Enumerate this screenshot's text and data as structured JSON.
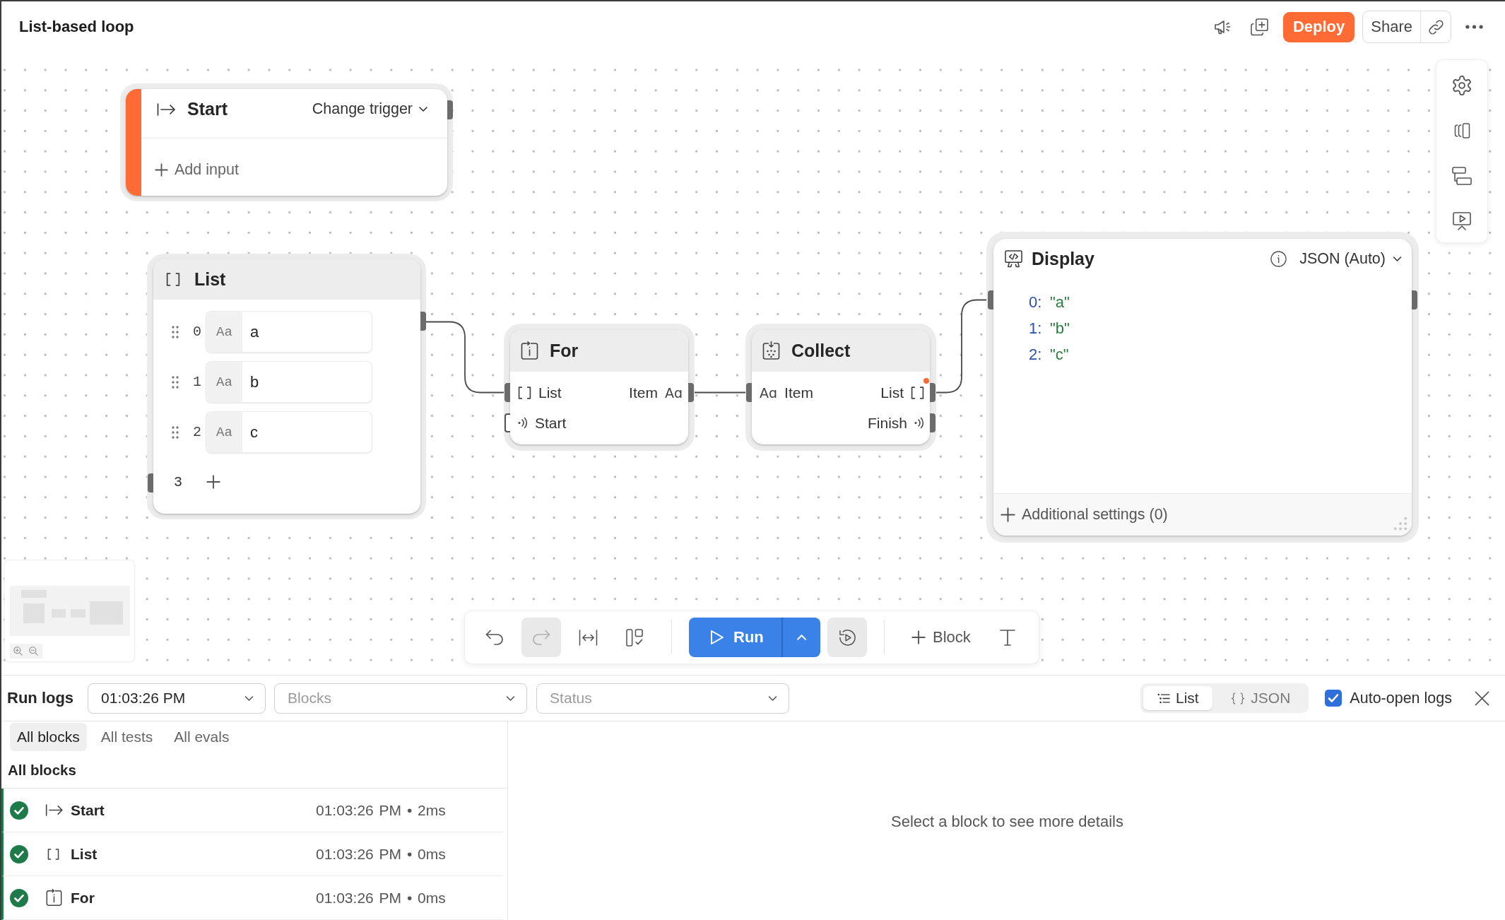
{
  "header": {
    "title": "List-based loop",
    "deploy": "Deploy",
    "share": "Share"
  },
  "canvas": {
    "start_block": {
      "title": "Start",
      "trigger": "Change trigger",
      "add_input": "Add input"
    },
    "list_block": {
      "title": "List",
      "items": [
        {
          "index": "0",
          "type": "Aa",
          "value": "a"
        },
        {
          "index": "1",
          "type": "Aa",
          "value": "b"
        },
        {
          "index": "2",
          "type": "Aa",
          "value": "c"
        }
      ],
      "count": "3"
    },
    "for_block": {
      "title": "For",
      "inputs": [
        {
          "kind": "list",
          "label": "List",
          "hollow": false
        },
        {
          "kind": "signal",
          "label": "Start",
          "hollow": true
        }
      ],
      "outputs": [
        {
          "kind": "text",
          "label": "Item",
          "type": "Aɑ",
          "hollow": false,
          "flagged": false
        }
      ]
    },
    "collect_block": {
      "title": "Collect",
      "inputs": [
        {
          "kind": "text",
          "label": "Item",
          "type": "Aɑ",
          "hollow": false
        }
      ],
      "outputs": [
        {
          "kind": "list",
          "label": "List",
          "hollow": false,
          "flagged": true
        },
        {
          "kind": "signal",
          "label": "Finish",
          "hollow": false,
          "flagged": false
        }
      ]
    },
    "display_block": {
      "title": "Display",
      "format": "JSON (Auto)",
      "entries": [
        {
          "key": "0:",
          "value": "\"a\""
        },
        {
          "key": "1:",
          "value": "\"b\""
        },
        {
          "key": "2:",
          "value": "\"c\""
        }
      ],
      "settings": "Additional settings (0)"
    },
    "toolbar": {
      "undo_disabled": false,
      "redo_disabled": true,
      "run": "Run",
      "add_block": "Block"
    }
  },
  "run_logs": {
    "title": "Run logs",
    "time_filter": {
      "value": "01:03:26 PM"
    },
    "block_filter": {
      "placeholder": "Blocks"
    },
    "status_filter": {
      "placeholder": "Status"
    },
    "views": [
      {
        "kind": "list",
        "label": "List",
        "selected": true
      },
      {
        "kind": "json",
        "label": "JSON",
        "selected": false
      }
    ],
    "auto_open": {
      "label": "Auto-open logs",
      "checked": true
    },
    "tabs": [
      {
        "label": "All blocks",
        "selected": true
      },
      {
        "label": "All tests",
        "selected": false
      },
      {
        "label": "All evals",
        "selected": false
      }
    ],
    "section_title": "All blocks",
    "entries": [
      {
        "kind": "start",
        "name": "Start",
        "time": "01:03:26 PM • 2ms",
        "passed": true
      },
      {
        "kind": "list",
        "name": "List",
        "time": "01:03:26 PM • 0ms",
        "passed": true
      },
      {
        "kind": "for",
        "name": "For",
        "time": "01:03:26 PM • 0ms",
        "passed": true
      }
    ],
    "detail_placeholder": "Select a block to see more details"
  }
}
